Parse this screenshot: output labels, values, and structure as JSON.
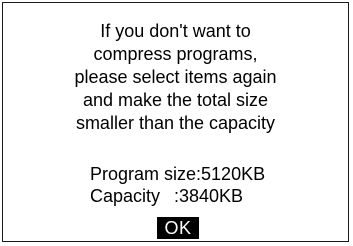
{
  "dialog": {
    "message_lines": [
      "If you don't want to",
      "compress programs,",
      "please select items again",
      "and make the total size",
      "smaller than the capacity"
    ],
    "program_size_label": "Program size",
    "program_size_value": ":5120KB",
    "capacity_label": "Capacity",
    "capacity_value": ":3840KB",
    "ok_label": "OK"
  }
}
